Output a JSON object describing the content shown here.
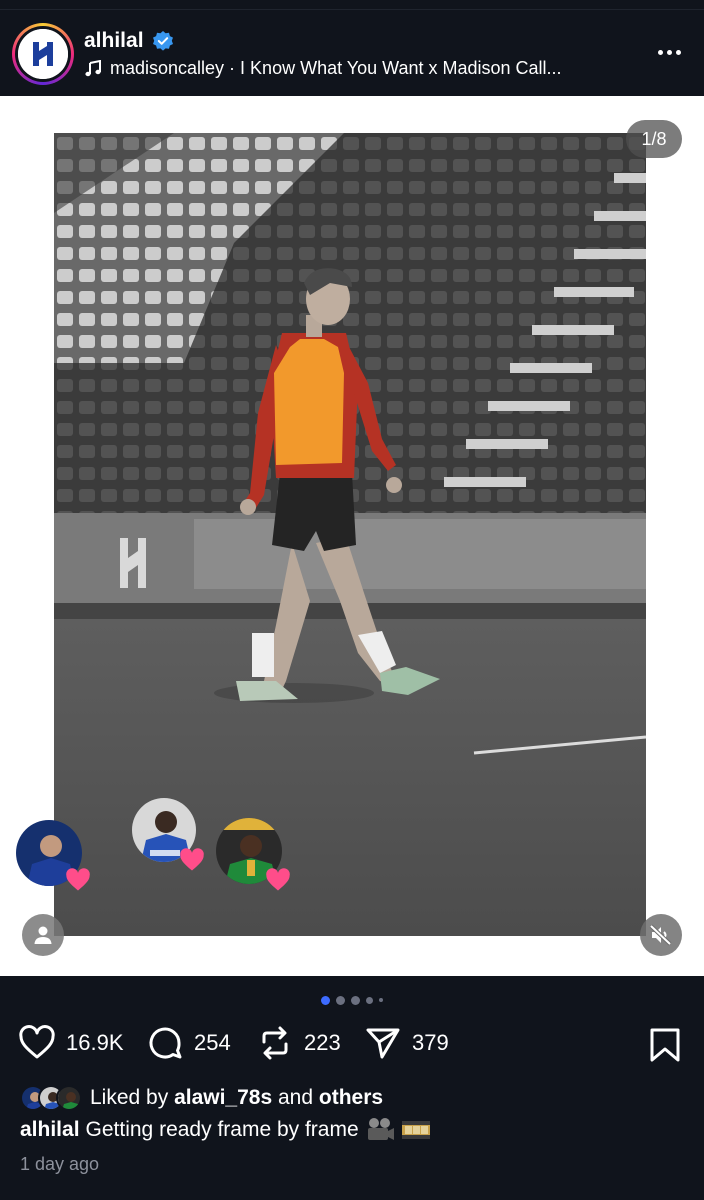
{
  "post": {
    "username": "alhilal",
    "audio": "madisoncalley · I Know What You Want x Madison Call...",
    "media_counter": "1/8",
    "carousel_active_index": 0,
    "carousel_dot_count": 5
  },
  "actions": {
    "likes": "16.9K",
    "comments": "254",
    "reposts": "223",
    "shares": "379"
  },
  "liked_by": {
    "prefix": "Liked by",
    "user": "alawi_78s",
    "conj": "and",
    "others": "others"
  },
  "caption": {
    "username": "alhilal",
    "text": "Getting ready frame by frame"
  },
  "timestamp": "1 day ago",
  "colors": {
    "background": "#10141c",
    "accent_blue": "#3d6bff",
    "heart_pink": "#ff3b7a",
    "verified_blue": "#3897f0"
  },
  "icons": [
    "music-icon",
    "verified-icon",
    "more-icon",
    "heart-icon",
    "comment-icon",
    "repost-icon",
    "share-icon",
    "bookmark-icon",
    "user-tag-icon",
    "muted-icon"
  ]
}
